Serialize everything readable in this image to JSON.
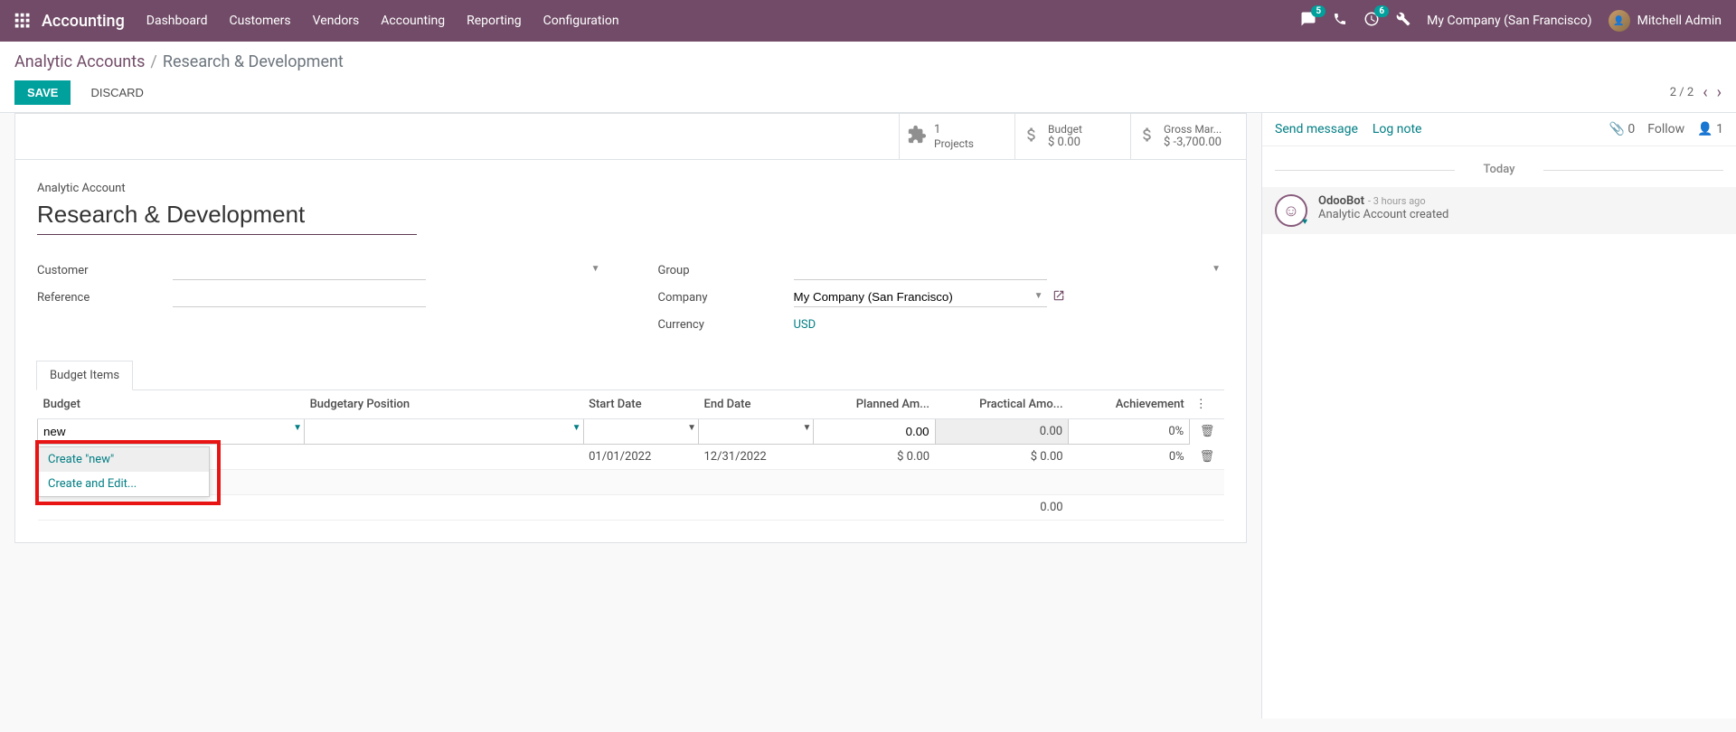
{
  "navbar": {
    "brand": "Accounting",
    "menu": [
      "Dashboard",
      "Customers",
      "Vendors",
      "Accounting",
      "Reporting",
      "Configuration"
    ],
    "messaging_badge": "5",
    "activities_badge": "6",
    "company": "My Company (San Francisco)",
    "user": "Mitchell Admin"
  },
  "breadcrumb": {
    "parent": "Analytic Accounts",
    "current": "Research & Development"
  },
  "buttons": {
    "save": "SAVE",
    "discard": "DISCARD"
  },
  "pager": {
    "text": "2 / 2"
  },
  "stat": {
    "projects_value": "1",
    "projects_label": "Projects",
    "budget_label": "Budget",
    "budget_value": "$ 0.00",
    "gross_label": "Gross Mar...",
    "gross_value": "$ -3,700.00"
  },
  "form": {
    "title_label": "Analytic Account",
    "title_value": "Research & Development",
    "customer_label": "Customer",
    "reference_label": "Reference",
    "group_label": "Group",
    "company_label": "Company",
    "company_value": "My Company (San Francisco)",
    "currency_label": "Currency",
    "currency_value": "USD"
  },
  "tabs": {
    "budget_items": "Budget Items"
  },
  "table": {
    "headers": {
      "budget": "Budget",
      "budgetary_position": "Budgetary Position",
      "start_date": "Start Date",
      "end_date": "End Date",
      "planned_amount": "Planned Am...",
      "practical_amount": "Practical Amo...",
      "achievement": "Achievement"
    },
    "edit_row": {
      "budget_input": "new",
      "planned": "0.00",
      "practical": "0.00",
      "achievement": "0%"
    },
    "row2": {
      "start": "01/01/2022",
      "end": "12/31/2022",
      "planned": "$ 0.00",
      "practical": "$ 0.00",
      "achievement": "0%"
    },
    "total_practical": "0.00"
  },
  "dropdown": {
    "create_new": "Create \"new\"",
    "create_edit": "Create and Edit..."
  },
  "chatter": {
    "send_message": "Send message",
    "log_note": "Log note",
    "attachments": "0",
    "follow": "Follow",
    "followers": "1",
    "today": "Today",
    "msg_author": "OdooBot",
    "msg_time": "- 3 hours ago",
    "msg_body": "Analytic Account created"
  }
}
